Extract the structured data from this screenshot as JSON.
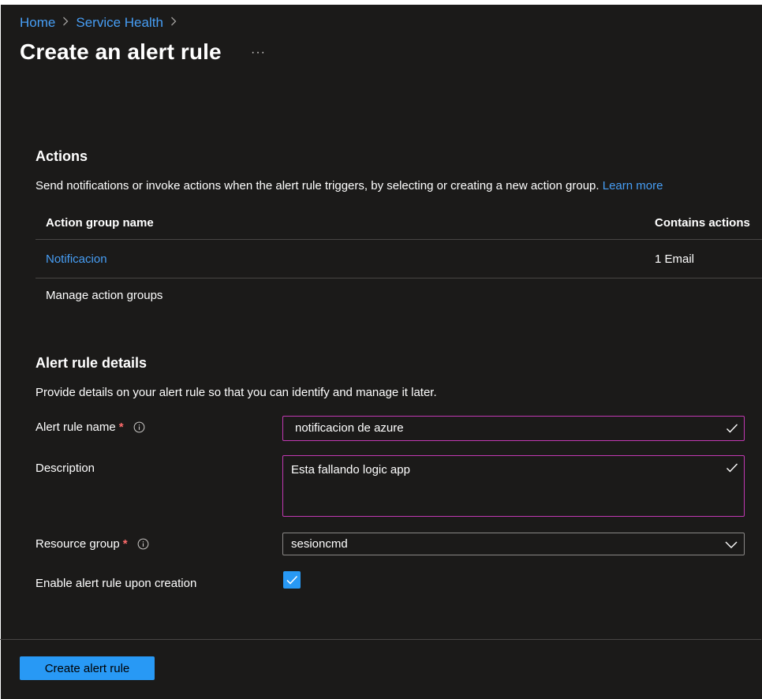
{
  "breadcrumb": {
    "items": [
      "Home",
      "Service Health"
    ],
    "separator": ">"
  },
  "page": {
    "title": "Create an alert rule",
    "more_label": "···"
  },
  "actions_section": {
    "heading": "Actions",
    "description": "Send notifications or invoke actions when the alert rule triggers, by selecting or creating a new action group.",
    "learn_more": "Learn more",
    "table": {
      "columns": [
        "Action group name",
        "Contains actions"
      ],
      "rows": [
        {
          "name": "Notificacion",
          "actions": "1 Email"
        }
      ]
    },
    "manage_link": "Manage action groups"
  },
  "details_section": {
    "heading": "Alert rule details",
    "description": "Provide details on your alert rule so that you can identify and manage it later.",
    "fields": {
      "rule_name": {
        "label": "Alert rule name",
        "required": "*",
        "value": "notificacion de azure"
      },
      "description": {
        "label": "Description",
        "value": "Esta fallando logic app"
      },
      "resource_group": {
        "label": "Resource group",
        "required": "*",
        "value": "sesioncmd"
      },
      "enable": {
        "label": "Enable alert rule upon creation",
        "checked": true
      }
    }
  },
  "footer": {
    "create_button": "Create alert rule"
  },
  "colors": {
    "background": "#1b1a19",
    "link": "#479ef5",
    "accent": "#2899f5",
    "input_border_valid": "#c239b3",
    "required": "#ff6b6b"
  },
  "icons": [
    "info-icon",
    "checkmark-icon",
    "chevron-down-icon",
    "chevron-right-icon",
    "more-icon"
  ]
}
